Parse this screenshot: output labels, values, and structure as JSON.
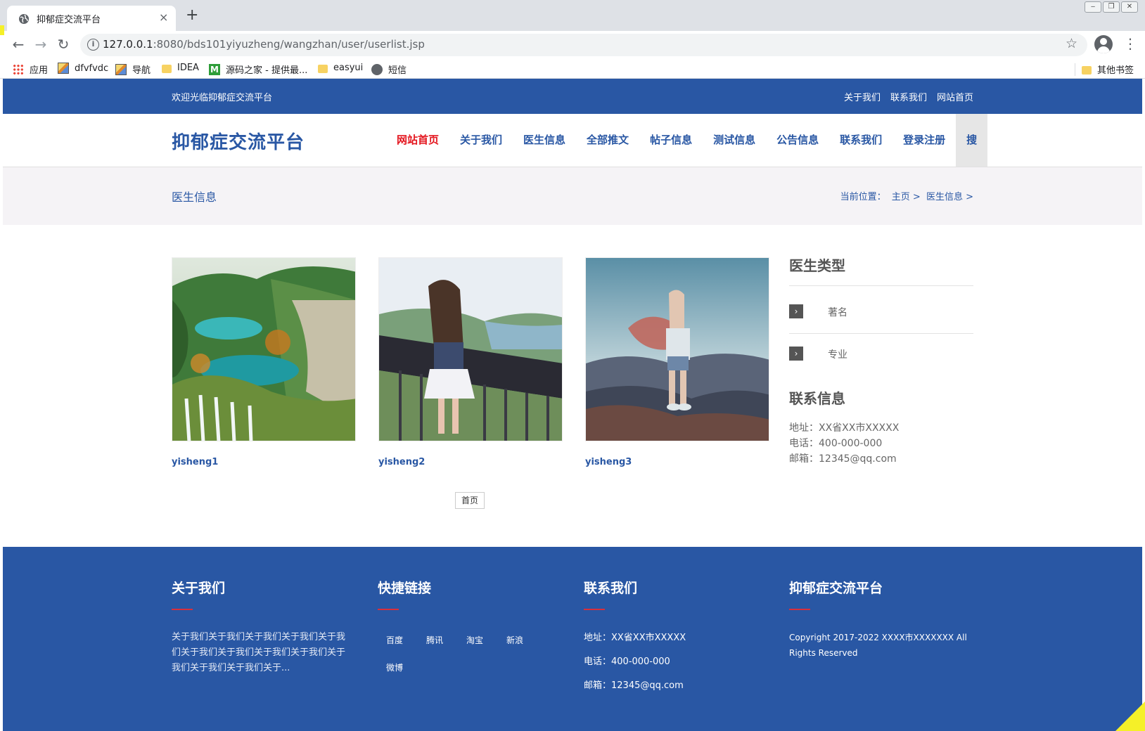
{
  "browser": {
    "tab_title": "抑郁症交流平台",
    "tab_close": "×",
    "new_tab": "+",
    "url_host": "127.0.0.1",
    "url_rest": ":8080/bds101yiyuzheng/wangzhan/user/userlist.jsp",
    "bookmarks": [
      "应用",
      "dfvfvdc",
      "导航",
      "IDEA",
      "源码之家 - 提供最...",
      "easyui",
      "短信"
    ],
    "other_bookmarks": "其他书签"
  },
  "site": {
    "topbar": {
      "welcome": "欢迎光临抑郁症交流平台",
      "links": [
        "关于我们",
        "联系我们",
        "网站首页"
      ]
    },
    "logo": "抑郁症交流平台",
    "nav": [
      "网站首页",
      "关于我们",
      "医生信息",
      "全部推文",
      "帖子信息",
      "测试信息",
      "公告信息",
      "联系我们",
      "登录注册"
    ],
    "nav_search": "搜",
    "banner": {
      "title": "医生信息",
      "crumbs_prefix": "当前位置：",
      "crumbs": [
        "主页 >",
        "医生信息 >"
      ]
    },
    "doctors": [
      "yisheng1",
      "yisheng2",
      "yisheng3"
    ],
    "pager_first": "首页",
    "sidebar": {
      "types_title": "医生类型",
      "types": [
        "著名",
        "专业"
      ],
      "contact_title": "联系信息",
      "address": "地址：XX省XX市XXXXX",
      "phone": "电话：400-000-000",
      "email": "邮箱：12345@qq.com"
    },
    "footer": {
      "about_title": "关于我们",
      "about_text": "关于我们关于我们关于我们关于我们关于我们关于我们关于我们关于我们关于我们关于我们关于我们关于我们关于...",
      "links_title": "快捷链接",
      "links": [
        "百度",
        "腾讯",
        "淘宝",
        "新浪",
        "微博"
      ],
      "contact_title": "联系我们",
      "address": "地址：XX省XX市XXXXX",
      "phone": "电话：400-000-000",
      "email": "邮箱：12345@qq.com",
      "brand_title": "抑郁症交流平台",
      "copyright": "Copyright 2017-2022 XXXX市XXXXXXX All Rights Reserved"
    }
  },
  "colors": {
    "brand_blue": "#2957a4",
    "active_red": "#e4161f",
    "footer_accent": "#d92f3c",
    "banner_bg": "#f5f3f6"
  }
}
